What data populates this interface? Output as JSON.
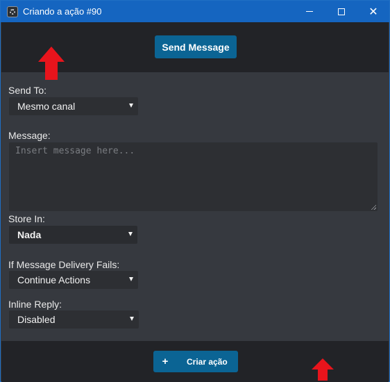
{
  "window": {
    "title": "Criando a ação #90",
    "minimize_icon": "minimize-icon",
    "maximize_icon": "maximize-icon",
    "close_icon": "close-icon",
    "close_glyph": "✕",
    "accent_color": "#1565c0"
  },
  "header": {
    "send_message_label": "Send Message"
  },
  "form": {
    "send_to": {
      "label": "Send To:",
      "value": "Mesmo canal"
    },
    "message": {
      "label": "Message:",
      "placeholder": "Insert message here..."
    },
    "store_in": {
      "label": "Store In:",
      "value": "Nada"
    },
    "delivery_fail": {
      "label": "If Message Delivery Fails:",
      "value": "Continue Actions"
    },
    "inline_reply": {
      "label": "Inline Reply:",
      "value": "Disabled"
    }
  },
  "footer": {
    "create_label": "Criar ação",
    "create_icon": "plus-icon",
    "plus_glyph": "+"
  },
  "annotations": {
    "arrow_color": "#e8141c",
    "arrows": [
      "up-arrow-icon",
      "up-arrow-icon"
    ]
  }
}
